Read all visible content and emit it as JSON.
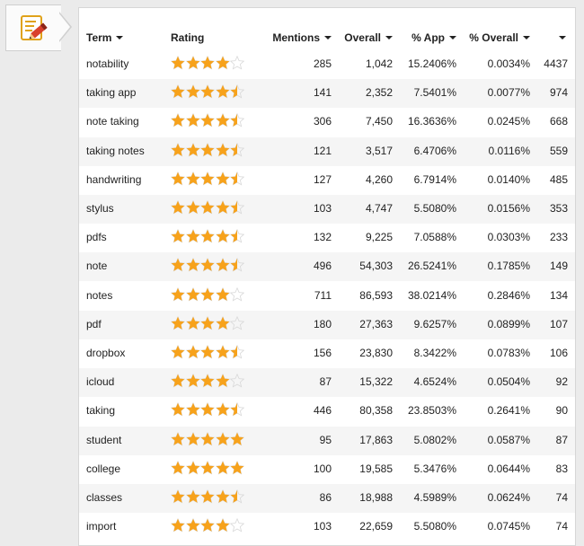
{
  "headers": {
    "term": "Term",
    "rating": "Rating",
    "mentions": "Mentions",
    "overall": "Overall",
    "pct_app": "% App",
    "pct_overall": "% Overall",
    "last": ""
  },
  "colors": {
    "star": "#f7a21b",
    "star_empty": "#d8d8d8"
  },
  "rows": [
    {
      "term": "notability",
      "rating": 4.0,
      "mentions": "285",
      "overall": "1,042",
      "pct_app": "15.2406%",
      "pct_overall": "0.0034%",
      "rank": "4437"
    },
    {
      "term": "taking app",
      "rating": 4.5,
      "mentions": "141",
      "overall": "2,352",
      "pct_app": "7.5401%",
      "pct_overall": "0.0077%",
      "rank": "974"
    },
    {
      "term": "note taking",
      "rating": 4.5,
      "mentions": "306",
      "overall": "7,450",
      "pct_app": "16.3636%",
      "pct_overall": "0.0245%",
      "rank": "668"
    },
    {
      "term": "taking notes",
      "rating": 4.5,
      "mentions": "121",
      "overall": "3,517",
      "pct_app": "6.4706%",
      "pct_overall": "0.0116%",
      "rank": "559"
    },
    {
      "term": "handwriting",
      "rating": 4.5,
      "mentions": "127",
      "overall": "4,260",
      "pct_app": "6.7914%",
      "pct_overall": "0.0140%",
      "rank": "485"
    },
    {
      "term": "stylus",
      "rating": 4.5,
      "mentions": "103",
      "overall": "4,747",
      "pct_app": "5.5080%",
      "pct_overall": "0.0156%",
      "rank": "353"
    },
    {
      "term": "pdfs",
      "rating": 4.5,
      "mentions": "132",
      "overall": "9,225",
      "pct_app": "7.0588%",
      "pct_overall": "0.0303%",
      "rank": "233"
    },
    {
      "term": "note",
      "rating": 4.5,
      "mentions": "496",
      "overall": "54,303",
      "pct_app": "26.5241%",
      "pct_overall": "0.1785%",
      "rank": "149"
    },
    {
      "term": "notes",
      "rating": 4.0,
      "mentions": "711",
      "overall": "86,593",
      "pct_app": "38.0214%",
      "pct_overall": "0.2846%",
      "rank": "134"
    },
    {
      "term": "pdf",
      "rating": 4.0,
      "mentions": "180",
      "overall": "27,363",
      "pct_app": "9.6257%",
      "pct_overall": "0.0899%",
      "rank": "107"
    },
    {
      "term": "dropbox",
      "rating": 4.5,
      "mentions": "156",
      "overall": "23,830",
      "pct_app": "8.3422%",
      "pct_overall": "0.0783%",
      "rank": "106"
    },
    {
      "term": "icloud",
      "rating": 4.0,
      "mentions": "87",
      "overall": "15,322",
      "pct_app": "4.6524%",
      "pct_overall": "0.0504%",
      "rank": "92"
    },
    {
      "term": "taking",
      "rating": 4.5,
      "mentions": "446",
      "overall": "80,358",
      "pct_app": "23.8503%",
      "pct_overall": "0.2641%",
      "rank": "90"
    },
    {
      "term": "student",
      "rating": 5.0,
      "mentions": "95",
      "overall": "17,863",
      "pct_app": "5.0802%",
      "pct_overall": "0.0587%",
      "rank": "87"
    },
    {
      "term": "college",
      "rating": 5.0,
      "mentions": "100",
      "overall": "19,585",
      "pct_app": "5.3476%",
      "pct_overall": "0.0644%",
      "rank": "83"
    },
    {
      "term": "classes",
      "rating": 4.5,
      "mentions": "86",
      "overall": "18,988",
      "pct_app": "4.5989%",
      "pct_overall": "0.0624%",
      "rank": "74"
    },
    {
      "term": "import",
      "rating": 4.0,
      "mentions": "103",
      "overall": "22,659",
      "pct_app": "5.5080%",
      "pct_overall": "0.0745%",
      "rank": "74"
    }
  ]
}
